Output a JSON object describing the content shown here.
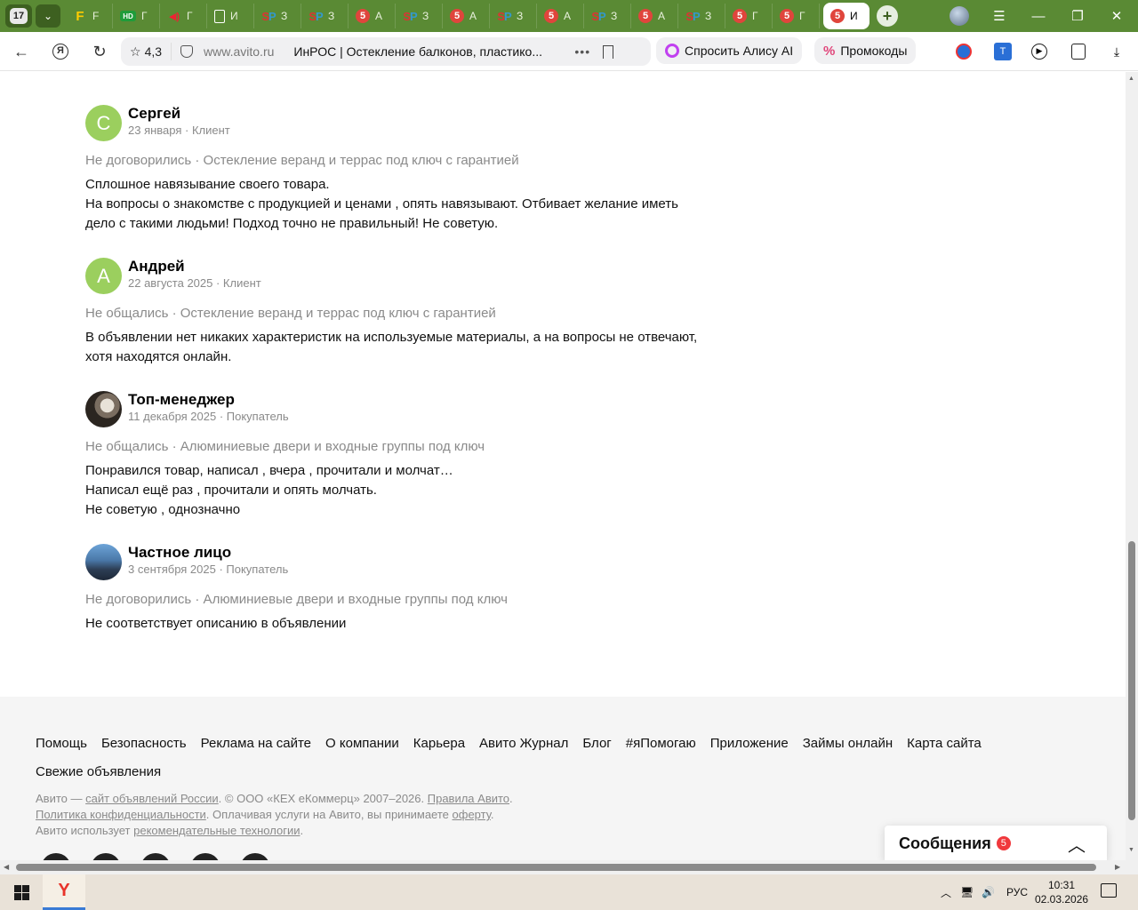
{
  "browser": {
    "tab_count": "17",
    "tabs": [
      {
        "icon": "f-icon",
        "label": "F"
      },
      {
        "icon": "hd-icon",
        "label": "Г",
        "badge": "HD"
      },
      {
        "icon": "speaker-icon",
        "label": "Г"
      },
      {
        "icon": "document-icon",
        "label": "И"
      },
      {
        "icon": "sp-icon",
        "label": "З"
      },
      {
        "icon": "sp-icon",
        "label": "З"
      },
      {
        "icon": "avito-icon",
        "label": "А",
        "badge": "5"
      },
      {
        "icon": "sp-icon",
        "label": "З"
      },
      {
        "icon": "avito-icon",
        "label": "А",
        "badge": "5"
      },
      {
        "icon": "sp-icon",
        "label": "З"
      },
      {
        "icon": "avito-icon",
        "label": "А",
        "badge": "5"
      },
      {
        "icon": "sp-icon",
        "label": "З"
      },
      {
        "icon": "avito-icon",
        "label": "А",
        "badge": "5"
      },
      {
        "icon": "sp-icon",
        "label": "З"
      },
      {
        "icon": "avito-icon",
        "label": "Г",
        "badge": "5"
      },
      {
        "icon": "avito-icon",
        "label": "Г",
        "badge": "5"
      }
    ],
    "active_tab": {
      "icon": "avito-icon",
      "label": "И",
      "badge": "5"
    },
    "omnibox": {
      "rating": "4,3",
      "domain": "www.avito.ru",
      "title": "ИнРОС | Остекление балконов, пластико..."
    },
    "alice_label": "Спросить Алису AI",
    "promo_label": "Промокоды",
    "colors": {
      "tabstrip": "#5a8a34",
      "avatar_green": "#9bcf5e",
      "badge_red": "#f0383c"
    }
  },
  "reviews": [
    {
      "avatar_letter": "С",
      "name": "Сергей",
      "date_role": "23 января · Клиент",
      "deal": "Не договорились · Остекление веранд и террас под ключ с гарантией",
      "text": [
        "Сплошное навязывание своего товара.",
        "На вопросы о знакомстве с продукцией и ценами , опять навязывают. Отбивает желание иметь",
        "дело с такими людьми! Подход точно не правильный! Не советую."
      ]
    },
    {
      "avatar_letter": "А",
      "name": "Андрей",
      "date_role": "22 августа 2025 · Клиент",
      "deal": "Не общались · Остекление веранд и террас под ключ с гарантией",
      "text": [
        "В объявлении нет никаких характеристик на используемые материалы, а на вопросы не отвечают,",
        "хотя находятся онлайн."
      ]
    },
    {
      "avatar_letter": "",
      "name": "Топ-менеджер",
      "date_role": "11 декабря 2025 · Покупатель",
      "deal": "Не общались · Алюминиевые двери и входные группы под ключ",
      "text": [
        "Понравился товар, написал , вчера , прочитали и молчат…",
        "Написал ещё раз , прочитали и опять молчать.",
        "Не советую , однозначно"
      ]
    },
    {
      "avatar_letter": "",
      "name": "Частное лицо",
      "date_role": "3 сентября 2025 · Покупатель",
      "deal": "Не договорились · Алюминиевые двери и входные группы под ключ",
      "text": [
        "Не соответствует описанию в объявлении"
      ]
    }
  ],
  "footer": {
    "links": [
      "Помощь",
      "Безопасность",
      "Реклама на сайте",
      "О компании",
      "Карьера",
      "Авито Журнал",
      "Блог",
      "#яПомогаю",
      "Приложение",
      "Займы онлайн",
      "Карта сайта",
      "Свежие объявления"
    ],
    "legal_1a": "Авито — ",
    "legal_1_link": "сайт объявлений России",
    "legal_1b": ". © ООО «КЕХ eКоммерц» 2007–2026. ",
    "legal_1_link2": "Правила Авито",
    "legal_1c": ".",
    "legal_2_link": "Политика конфиденциальности",
    "legal_2a": ". Оплачивая услуги на Авито, вы принимаете ",
    "legal_2_link2": "оферту",
    "legal_2b": ".",
    "legal_3a": "Авито использует ",
    "legal_3_link": "рекомендательные технологии",
    "legal_3b": "."
  },
  "messages": {
    "label": "Сообщения",
    "count": "5"
  },
  "taskbar": {
    "lang": "РУС",
    "time": "10:31",
    "date": "02.03.2026"
  }
}
